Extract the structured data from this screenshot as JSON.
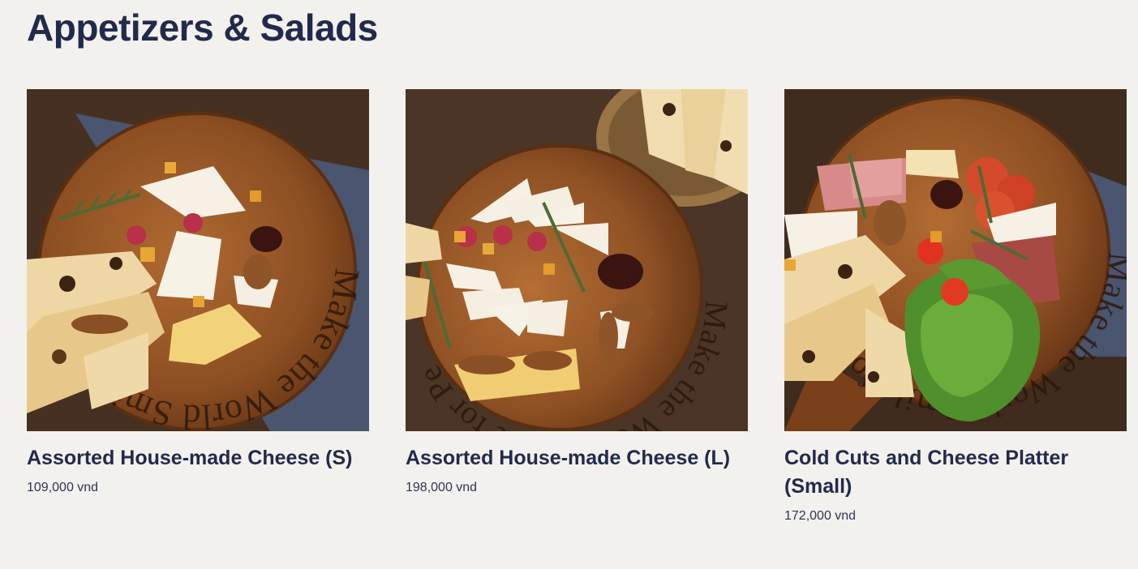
{
  "section": {
    "title": "Appetizers & Salads"
  },
  "items": [
    {
      "name": "Assorted House-made Cheese (S)",
      "price": "109,000 vnd",
      "image_alt": "Assorted house-made cheese board, small"
    },
    {
      "name": "Assorted House-made Cheese (L)",
      "price": "198,000 vnd",
      "image_alt": "Assorted house-made cheese board, large"
    },
    {
      "name": "Cold Cuts and Cheese Platter (Small)",
      "price": "172,000 vnd",
      "image_alt": "Cold cuts and cheese platter with salad"
    }
  ],
  "board_text": "Make the World Smile for Pe",
  "colors": {
    "heading": "#222a4c",
    "background": "#f3f1ee",
    "wood_table": "#4a3526",
    "board": "#9a5a2a",
    "napkin": "#4e5a72"
  }
}
